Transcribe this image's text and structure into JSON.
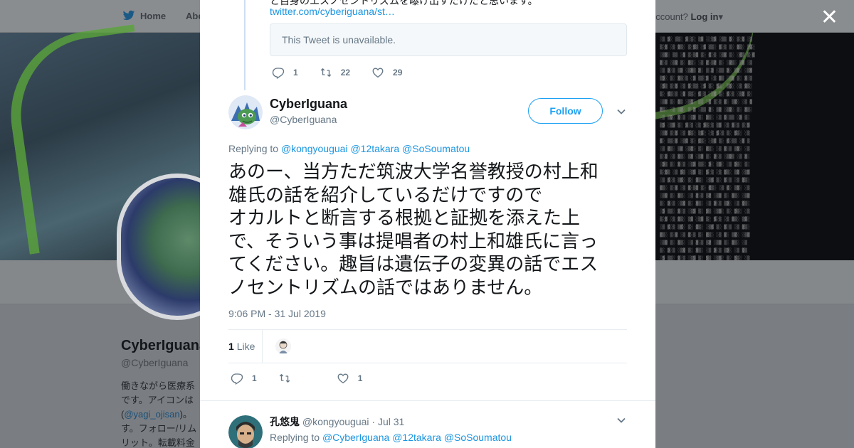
{
  "nav": {
    "home_label": "Home",
    "about_label": "Abo",
    "account_prompt": "ccount?",
    "login_label": "Log in"
  },
  "background_profile": {
    "display_name": "CyberIguana",
    "handle": "@CyberIguana",
    "bio_line1": "働きながら医療系",
    "bio_line2": "です。アイコンは",
    "bio_line3_prefix": "(",
    "bio_line3_link": "@yagi_ojisan",
    "bio_line3_suffix": ")。",
    "bio_line4": "す。フォロー/リム",
    "bio_line5": "リット。転載料金"
  },
  "previous_tweet": {
    "cut_text": "と自身のエスノセントリズムを曝け出すだけだと思います。",
    "link": "twitter.com/cyberiguana/st…",
    "unavailable_text": "This Tweet is unavailable.",
    "replies": "1",
    "retweets": "22",
    "likes": "29"
  },
  "main_tweet": {
    "author_name": "CyberIguana",
    "author_handle": "@CyberIguana",
    "follow_label": "Follow",
    "replying_prefix": "Replying to",
    "mentions": [
      "@kongyouguai",
      "@12takara",
      "@SoSoumatou"
    ],
    "text_lines": [
      "あのー、当方ただ筑波大学名誉教授の村上和",
      "雄氏の話を紹介しているだけですので",
      "オカルトと断言する根拠と証拠を添えた上",
      "で、そういう事は提唱者の村上和雄氏に言っ",
      "てください。趣旨は遺伝子の変異の話でエス",
      "ノセントリズムの話ではありません。"
    ],
    "timestamp": "9:06 PM - 31 Jul 2019",
    "like_count": "1",
    "like_label": "Like",
    "action_replies": "1",
    "action_likes": "1"
  },
  "reply_tweet": {
    "author_name": "孔悠鬼",
    "author_handle": "@kongyouguai",
    "date": "· Jul 31",
    "replying_prefix": "Replying to",
    "mentions": [
      "@CyberIguana",
      "@12takara",
      "@SoSoumatou"
    ]
  },
  "colors": {
    "accent": "#1da1f2",
    "link": "#1b95e0",
    "muted": "#657786",
    "text": "#14171a",
    "overlay": "#7a7e83"
  },
  "icons": [
    "twitter-bird-icon",
    "caret-down-icon",
    "close-icon",
    "reply-icon",
    "retweet-icon",
    "like-icon",
    "chevron-down-icon"
  ]
}
